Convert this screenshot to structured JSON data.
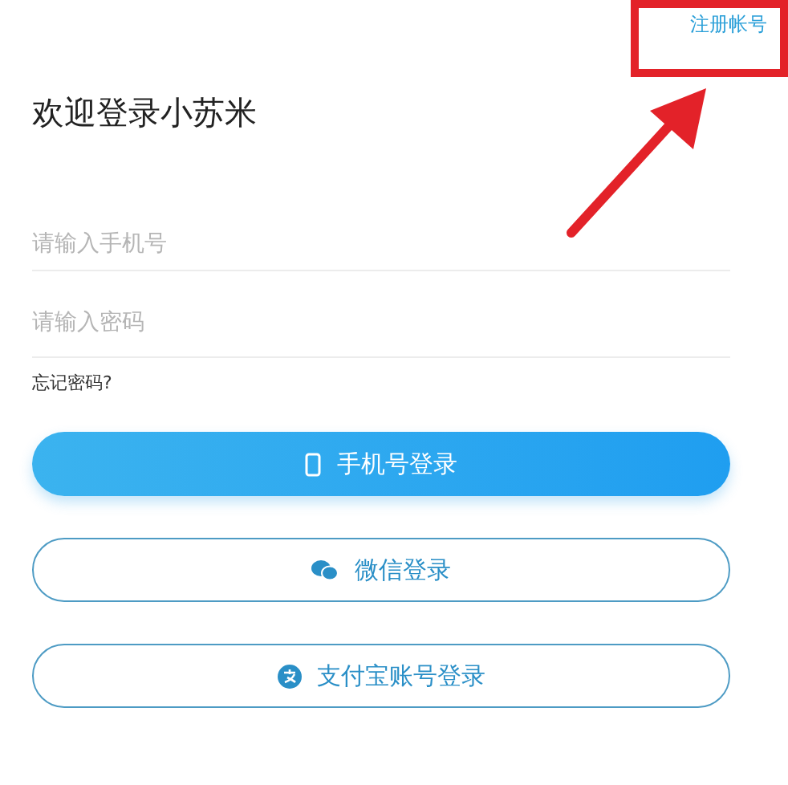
{
  "register_link": "注册帐号",
  "title": "欢迎登录小苏米",
  "fields": [
    {
      "placeholder": "请输入手机号"
    },
    {
      "placeholder": "请输入密码"
    }
  ],
  "forgot_password": "忘记密码?",
  "buttons": [
    {
      "label": "手机号登录",
      "kind": "primary"
    },
    {
      "label": "微信登录",
      "kind": "outline"
    },
    {
      "label": "支付宝账号登录",
      "kind": "outline"
    }
  ]
}
